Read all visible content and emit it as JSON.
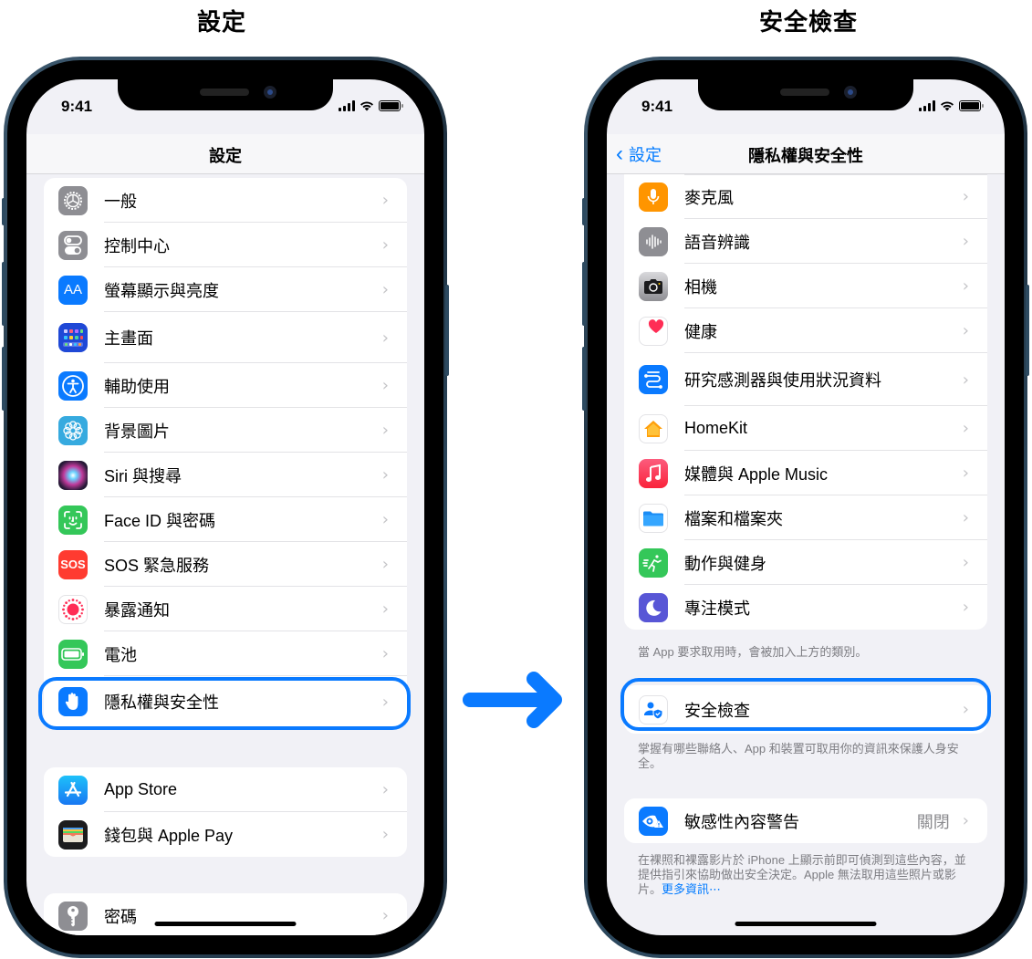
{
  "captions": {
    "left": "設定",
    "right": "安全檢查"
  },
  "colors": {
    "accent": "#007aff",
    "highlight": "#0a7aff",
    "arrow": "#0a7aff"
  },
  "left_phone": {
    "status": {
      "time": "9:41"
    },
    "nav_title": "設定",
    "groups": [
      {
        "items": [
          {
            "label": "一般",
            "icon": "gear-icon",
            "bg": "#8e8e93"
          },
          {
            "label": "控制中心",
            "icon": "toggles-icon",
            "bg": "#8e8e93"
          },
          {
            "label": "螢幕顯示與亮度",
            "icon": "text-size-icon",
            "bg": "#0a7aff"
          },
          {
            "label": "主畫面",
            "icon": "home-screen-icon",
            "bg": "#1f48d6"
          },
          {
            "label": "輔助使用",
            "icon": "accessibility-icon",
            "bg": "#0a7aff"
          },
          {
            "label": "背景圖片",
            "icon": "wallpaper-flower-icon",
            "bg": "#36aadf"
          },
          {
            "label": "Siri 與搜尋",
            "icon": "siri-icon",
            "bg": "#1b1b2a"
          },
          {
            "label": "Face ID 與密碼",
            "icon": "face-id-icon",
            "bg": "#34c759"
          },
          {
            "label": "SOS 緊急服務",
            "icon": "sos-icon",
            "bg": "#ff3b30"
          },
          {
            "label": "暴露通知",
            "icon": "exposure-notification-icon",
            "bg": "#ffffff"
          },
          {
            "label": "電池",
            "icon": "battery-icon",
            "bg": "#34c759"
          },
          {
            "label": "隱私權與安全性",
            "icon": "hand-icon",
            "bg": "#0a7aff"
          }
        ]
      },
      {
        "items": [
          {
            "label": "App Store",
            "icon": "app-store-icon",
            "bg": "#1e8ef5"
          },
          {
            "label": "錢包與 Apple Pay",
            "icon": "wallet-icon",
            "bg": "#1c1c1e"
          }
        ]
      },
      {
        "items": [
          {
            "label": "密碼",
            "icon": "key-icon",
            "bg": "#8e8e93"
          }
        ]
      }
    ],
    "sos_text": "SOS",
    "aa_text": "AA"
  },
  "right_phone": {
    "status": {
      "time": "9:41"
    },
    "back_label": "設定",
    "nav_title": "隱私權與安全性",
    "groups": [
      {
        "items": [
          {
            "label": "麥克風",
            "icon": "microphone-icon",
            "bg": "#ff9500"
          },
          {
            "label": "語音辨識",
            "icon": "speech-waveform-icon",
            "bg": "#8e8e93"
          },
          {
            "label": "相機",
            "icon": "camera-icon",
            "bg": "#6c6c70"
          },
          {
            "label": "健康",
            "icon": "health-heart-icon",
            "bg": "#ffffff"
          },
          {
            "label": "研究感測器與使用狀況資料",
            "icon": "research-sensor-icon",
            "bg": "#0a7aff"
          },
          {
            "label": "HomeKit",
            "icon": "homekit-icon",
            "bg": "#ffffff"
          },
          {
            "label": "媒體與 Apple Music",
            "icon": "music-note-icon",
            "bg": "#fc3c53"
          },
          {
            "label": "檔案和檔案夾",
            "icon": "folder-icon",
            "bg": "#ffffff"
          },
          {
            "label": "動作與健身",
            "icon": "fitness-run-icon",
            "bg": "#34c759"
          },
          {
            "label": "專注模式",
            "icon": "moon-icon",
            "bg": "#5856d6"
          }
        ],
        "footer": "當 App 要求取用時，會被加入上方的類別。"
      },
      {
        "items": [
          {
            "label": "安全檢查",
            "icon": "safety-check-icon",
            "bg": "#ffffff"
          }
        ],
        "footer": "掌握有哪些聯絡人、App 和裝置可取用你的資訊來保護人身安全。"
      },
      {
        "items": [
          {
            "label": "敏感性內容警告",
            "icon": "sensitive-content-eye-icon",
            "bg": "#0a7aff",
            "value": "關閉"
          }
        ],
        "footer": "在裸照和裸露影片於 iPhone 上顯示前即可偵測到這些內容，並提供指引來協助做出安全決定。Apple 無法取用這些照片或影片。",
        "footer_link": "更多資訊⋯"
      }
    ]
  }
}
